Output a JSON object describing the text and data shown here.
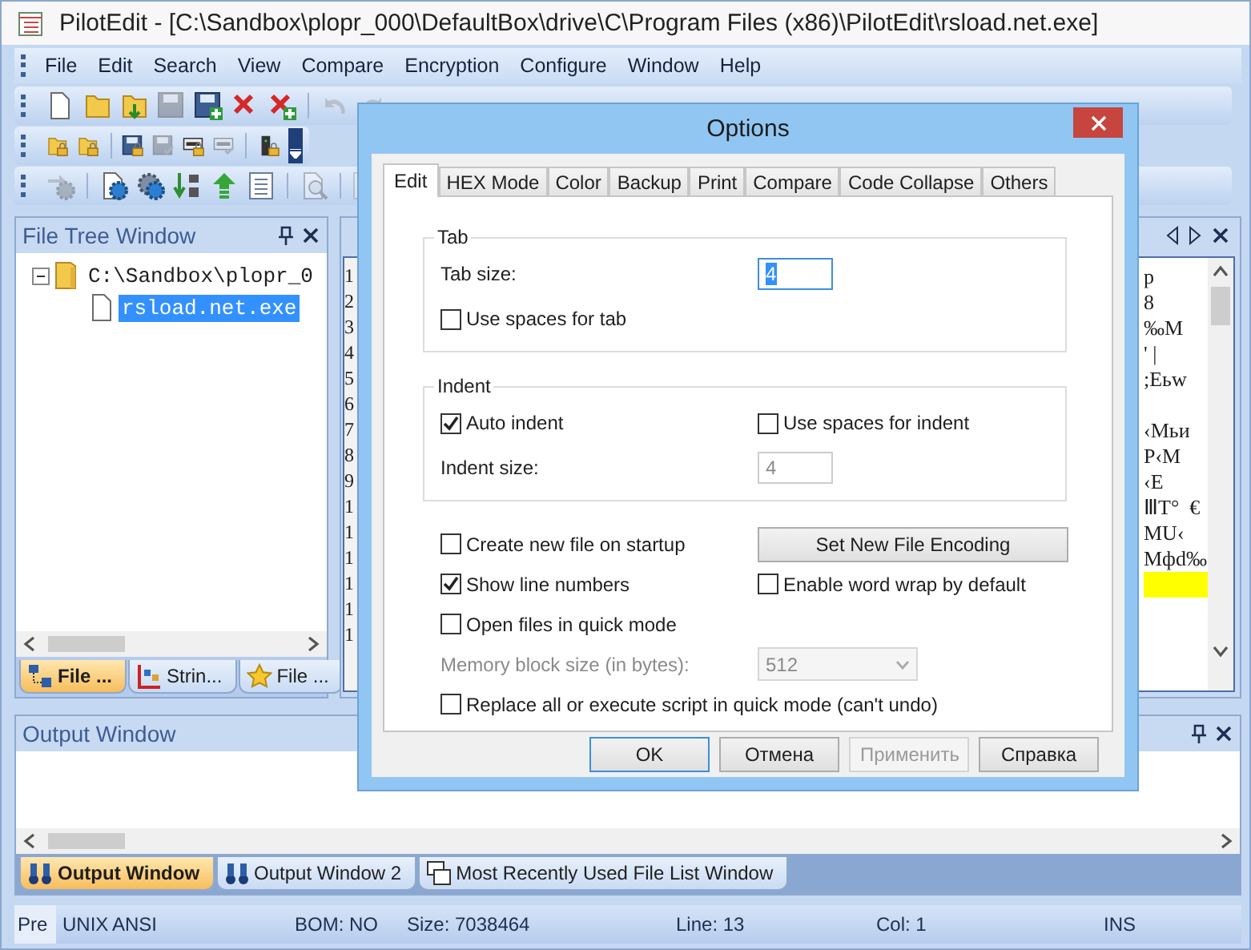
{
  "window": {
    "title": "PilotEdit - [C:\\Sandbox\\plopr_000\\DefaultBox\\drive\\C\\Program Files (x86)\\PilotEdit\\rsload.net.exe]"
  },
  "menu": [
    "File",
    "Edit",
    "Search",
    "View",
    "Compare",
    "Encryption",
    "Configure",
    "Window",
    "Help"
  ],
  "toolbars": [
    {
      "buttons": [
        {
          "kind": "new",
          "disabled": false
        },
        {
          "kind": "open",
          "disabled": false
        },
        {
          "kind": "open-down",
          "disabled": false
        },
        {
          "kind": "save",
          "disabled": true
        },
        {
          "kind": "save-add",
          "disabled": false
        },
        {
          "kind": "close",
          "disabled": false
        },
        {
          "kind": "close-add",
          "disabled": false
        },
        {
          "kind": "separator"
        },
        {
          "kind": "undo",
          "disabled": true
        },
        {
          "kind": "redo",
          "disabled": true
        }
      ]
    },
    {
      "buttons": [
        {
          "kind": "lock-folder",
          "disabled": false
        },
        {
          "kind": "lock-folder",
          "disabled": false
        },
        {
          "kind": "separator"
        },
        {
          "kind": "save-lock",
          "disabled": false
        },
        {
          "kind": "save-check",
          "disabled": true
        },
        {
          "kind": "monitor-lock",
          "disabled": false
        },
        {
          "kind": "monitor-check",
          "disabled": true
        },
        {
          "kind": "separator"
        },
        {
          "kind": "server-lock",
          "disabled": false
        },
        {
          "kind": "overflow"
        }
      ]
    },
    {
      "buttons": [
        {
          "kind": "arrows-gear",
          "disabled": true
        },
        {
          "kind": "separator"
        },
        {
          "kind": "page-gear",
          "disabled": false
        },
        {
          "kind": "gears",
          "disabled": false
        },
        {
          "kind": "sort",
          "disabled": false
        },
        {
          "kind": "arrow-up",
          "disabled": false
        },
        {
          "kind": "list",
          "disabled": false
        },
        {
          "kind": "separator"
        },
        {
          "kind": "find",
          "disabled": true
        },
        {
          "kind": "separator"
        },
        {
          "kind": "updown",
          "disabled": true
        }
      ]
    }
  ],
  "file_tree": {
    "title": "File Tree Window",
    "items": [
      {
        "label": "C:\\Sandbox\\plopr_0",
        "expanded": true,
        "selected": false,
        "children": [
          {
            "label": "rsload.net.exe",
            "selected": true
          }
        ]
      }
    ],
    "tabs": [
      {
        "label": "File ...",
        "selected": true,
        "kind": "tree"
      },
      {
        "label": "Strin...",
        "selected": false,
        "kind": "strings"
      },
      {
        "label": "File ...",
        "selected": false,
        "kind": "star"
      }
    ]
  },
  "editor": {
    "lines": [
      {
        "number": "1",
        "text": "p",
        "current": false
      },
      {
        "number": "2",
        "text": "8",
        "current": false
      },
      {
        "number": "3",
        "text": "‰M",
        "current": false
      },
      {
        "number": "4",
        "text": "' |",
        "current": false
      },
      {
        "number": "5",
        "text": ";Еьw",
        "current": false
      },
      {
        "number": "6",
        "current": false
      },
      {
        "number": "7",
        "text": "‹Мьи",
        "current": false
      },
      {
        "number": "8",
        "text": "Р‹М",
        "current": false
      },
      {
        "number": "9",
        "text": "‹Е",
        "current": false
      },
      {
        "number": "1",
        "text": "ⅢТ°  €",
        "current": false
      },
      {
        "number": "1",
        "text": "МU‹",
        "current": false
      },
      {
        "number": "1",
        "text": "Мфd‰",
        "current": false
      },
      {
        "number": "1",
        "current": true
      },
      {
        "number": "1",
        "current": false
      },
      {
        "number": "1",
        "current": false
      }
    ]
  },
  "output": {
    "title": "Output Window",
    "tabs": [
      {
        "label": "Output Window",
        "selected": true
      },
      {
        "label": "Output Window 2",
        "selected": false
      },
      {
        "label": "Most Recently Used File List Window",
        "selected": false,
        "kind": "list"
      }
    ]
  },
  "status_bar": [
    "Pre",
    "UNIX",
    "ANSI",
    "BOM: NO",
    "Size: 7038464",
    "Line: 13",
    "Col: 1",
    "INS"
  ],
  "dialog": {
    "title": "Options",
    "tabs": [
      {
        "label": "Edit",
        "selected": true
      },
      {
        "label": "HEX Mode",
        "selected": false
      },
      {
        "label": "Color",
        "selected": false
      },
      {
        "label": "Backup",
        "selected": false
      },
      {
        "label": "Print",
        "selected": false
      },
      {
        "label": "Compare",
        "selected": false
      },
      {
        "label": "Code Collapse",
        "selected": false
      },
      {
        "label": "Others",
        "selected": false
      }
    ],
    "groups": [
      {
        "legend": "Tab",
        "rows": [
          [
            {
              "kind": "field",
              "label": "Tab size:",
              "value": "4",
              "focused": true,
              "disabled": false
            }
          ],
          [
            {
              "kind": "checkbox",
              "label": "Use spaces for tab",
              "checked": false
            }
          ]
        ]
      },
      {
        "legend": "Indent",
        "rows": [
          [
            {
              "kind": "checkbox",
              "label": "Auto indent",
              "checked": true
            },
            {
              "kind": "checkbox",
              "label": "Use spaces for indent",
              "checked": false
            }
          ],
          [
            {
              "kind": "field",
              "label": "Indent size:",
              "value": "4",
              "focused": false,
              "disabled": true
            }
          ]
        ]
      }
    ],
    "rows": [
      [
        {
          "kind": "checkbox",
          "label": "Create new file on startup",
          "checked": false
        },
        {
          "kind": "button",
          "label": "Set New File Encoding"
        }
      ],
      [
        {
          "kind": "checkbox",
          "label": "Show line numbers",
          "checked": true
        },
        {
          "kind": "checkbox",
          "label": "Enable word wrap by default",
          "checked": false
        }
      ],
      [
        {
          "kind": "checkbox",
          "label": "Open files in quick mode",
          "checked": false
        }
      ],
      [
        {
          "kind": "select",
          "label": "Memory block size (in bytes):",
          "value": "512",
          "disabled": true
        }
      ],
      [
        {
          "kind": "checkbox",
          "label": "Replace all or execute script in quick mode (can't undo)",
          "checked": false
        }
      ]
    ],
    "buttons": [
      {
        "label": "OK",
        "default": true,
        "disabled": false
      },
      {
        "label": "Отмена",
        "default": false,
        "disabled": false
      },
      {
        "label": "Применить",
        "default": false,
        "disabled": true
      },
      {
        "label": "Справка",
        "default": false,
        "disabled": false
      }
    ]
  }
}
